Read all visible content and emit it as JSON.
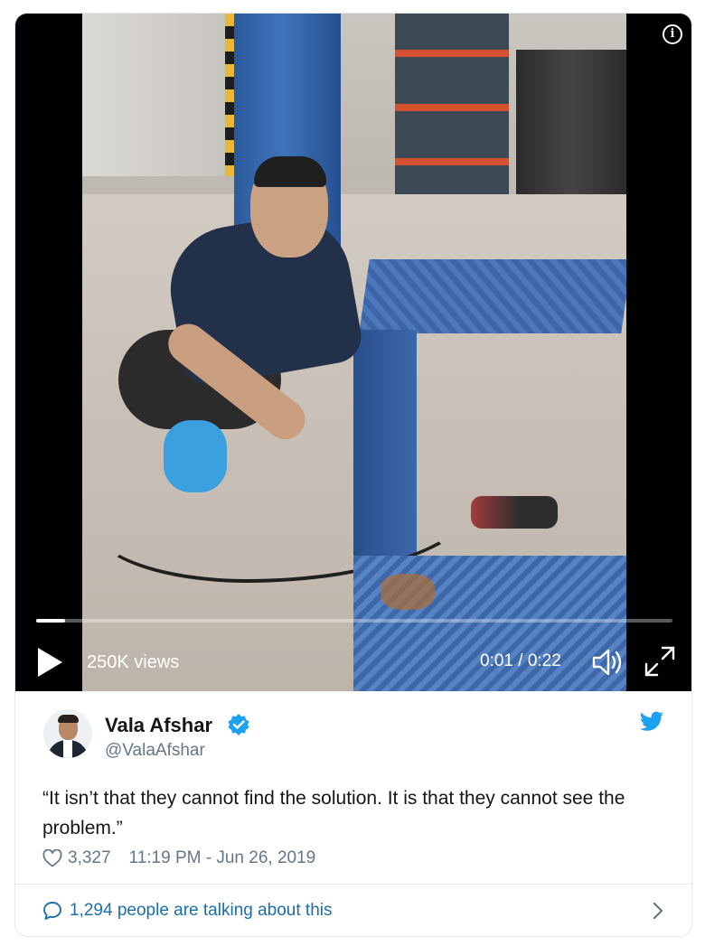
{
  "video": {
    "views": "250K views",
    "time": "0:01 / 0:22",
    "progress": 0.045
  },
  "author": {
    "name": "Vala Afshar",
    "handle": "@ValaAfshar"
  },
  "tweet": {
    "text": "“It isn’t that they cannot find the solution. It is that they cannot see the problem.”",
    "likes": "3,327",
    "timestamp": "11:19 PM - Jun 26, 2019"
  },
  "footer": {
    "talking": "1,294 people are talking about this"
  },
  "colors": {
    "accent": "#1da1f2",
    "link": "#1b6fa8",
    "muted": "#657786"
  },
  "icons": [
    "info-icon",
    "play-icon",
    "volume-icon",
    "fullscreen-icon",
    "verified-icon",
    "twitter-bird-icon",
    "heart-icon",
    "comment-icon",
    "chevron-right-icon"
  ]
}
